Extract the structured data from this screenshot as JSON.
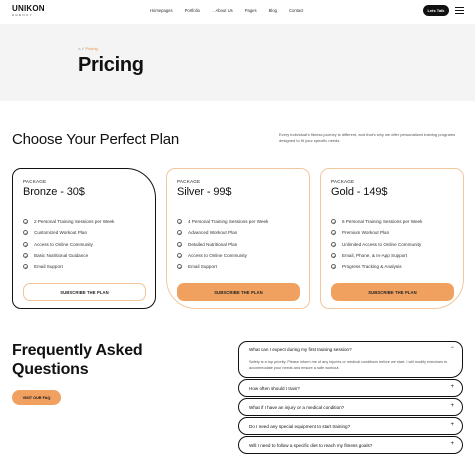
{
  "header": {
    "logo_main": "UNIKON",
    "logo_sub": "AGENCY",
    "nav": [
      {
        "label": "Homepages",
        "has_dropdown": false
      },
      {
        "label": "Portfolio",
        "has_dropdown": false
      },
      {
        "label": "About Us",
        "has_dropdown": true
      },
      {
        "label": "Pages",
        "has_dropdown": false
      },
      {
        "label": "Blog",
        "has_dropdown": false
      },
      {
        "label": "Contact",
        "has_dropdown": false
      }
    ],
    "cta_label": "Lets Talk"
  },
  "hero": {
    "breadcrumb_home": "⌂",
    "breadcrumb_sep": "/",
    "breadcrumb_current": "Pricing",
    "title": "Pricing"
  },
  "plans": {
    "title": "Choose Your Perfect Plan",
    "description": "Every individual's fitness journey is different, and that's why we offer personalized training programs designed to fit your specific needs.",
    "cards": [
      {
        "package_label": "PACKAGE",
        "name": "Bronze - 30$",
        "features": [
          "2 Personal Training Sessions per Week",
          "Customized Workout Plan",
          "Access to Online Community",
          "Basic Nutritional Guidance",
          "Email Support"
        ],
        "button_label": "SUBSCRIBE THE PLAN"
      },
      {
        "package_label": "PACKAGE",
        "name": "Silver - 99$",
        "features": [
          "4 Personal Training Sessions per Week",
          "Advanced Workout Plan",
          "Detailed Nutritional Plan",
          "Access to Online Community",
          "Email Support"
        ],
        "button_label": "SUBSCRIBE THE PLAN"
      },
      {
        "package_label": "PACKAGE",
        "name": "Gold - 149$",
        "features": [
          "6 Personal Training Sessions per Week",
          "Premium Workout Plan",
          "Unlimited Access to Online Community",
          "Email, Phone, & In-App Support",
          "Progress Tracking & Analysis"
        ],
        "button_label": "SUBSCRIBE THE PLAN"
      }
    ]
  },
  "faq": {
    "title": "Frequently Asked Questions",
    "visit_label": "VISIT OUR FAQ",
    "open_item": {
      "question": "What can I expect during my first training session?",
      "answer": "Safety is a top priority. Please inform me of any injuries or medical conditions before we start. I will modify exercises to accommodate your needs and ensure a safe workout.",
      "toggle": "−"
    },
    "items": [
      {
        "question": "How often should I train?",
        "toggle": "+"
      },
      {
        "question": "What if I have an injury or a medical condition?",
        "toggle": "+"
      },
      {
        "question": "Do I need any special equipment to start training?",
        "toggle": "+"
      },
      {
        "question": "Will I need to follow a specific diet to reach my fitness goals?",
        "toggle": "+"
      }
    ]
  },
  "colors": {
    "accent": "#f0a160",
    "accent_border": "#f2c79d",
    "hero_bg": "#f4f4f4",
    "dark": "#111111"
  }
}
